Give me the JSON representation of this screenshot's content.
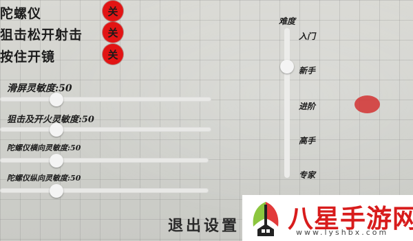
{
  "toggles": [
    {
      "label": "陀螺仪",
      "state": "关"
    },
    {
      "label": "狙击松开射击",
      "state": "关"
    },
    {
      "label": "按住开镜",
      "state": "关"
    }
  ],
  "sliders": [
    {
      "label": "滑屏灵敏度:50",
      "value": 50
    },
    {
      "label": "狙击及开火灵敏度:50",
      "value": 50
    },
    {
      "label": "陀螺仪横向灵敏度:50",
      "value": 50
    },
    {
      "label": "陀螺仪纵向灵敏度:50",
      "value": 50
    }
  ],
  "difficulty": {
    "title": "难度",
    "levels": [
      "入门",
      "新手",
      "进阶",
      "高手",
      "专家"
    ],
    "selected": "新手"
  },
  "exit_label": "退出设置",
  "watermark": {
    "name": "八星手游网",
    "url": "www.lyshbx.com"
  },
  "colors": {
    "toggle_red": "#e21414",
    "watermark_red": "#d81c1c",
    "blob_red": "#d22828"
  }
}
